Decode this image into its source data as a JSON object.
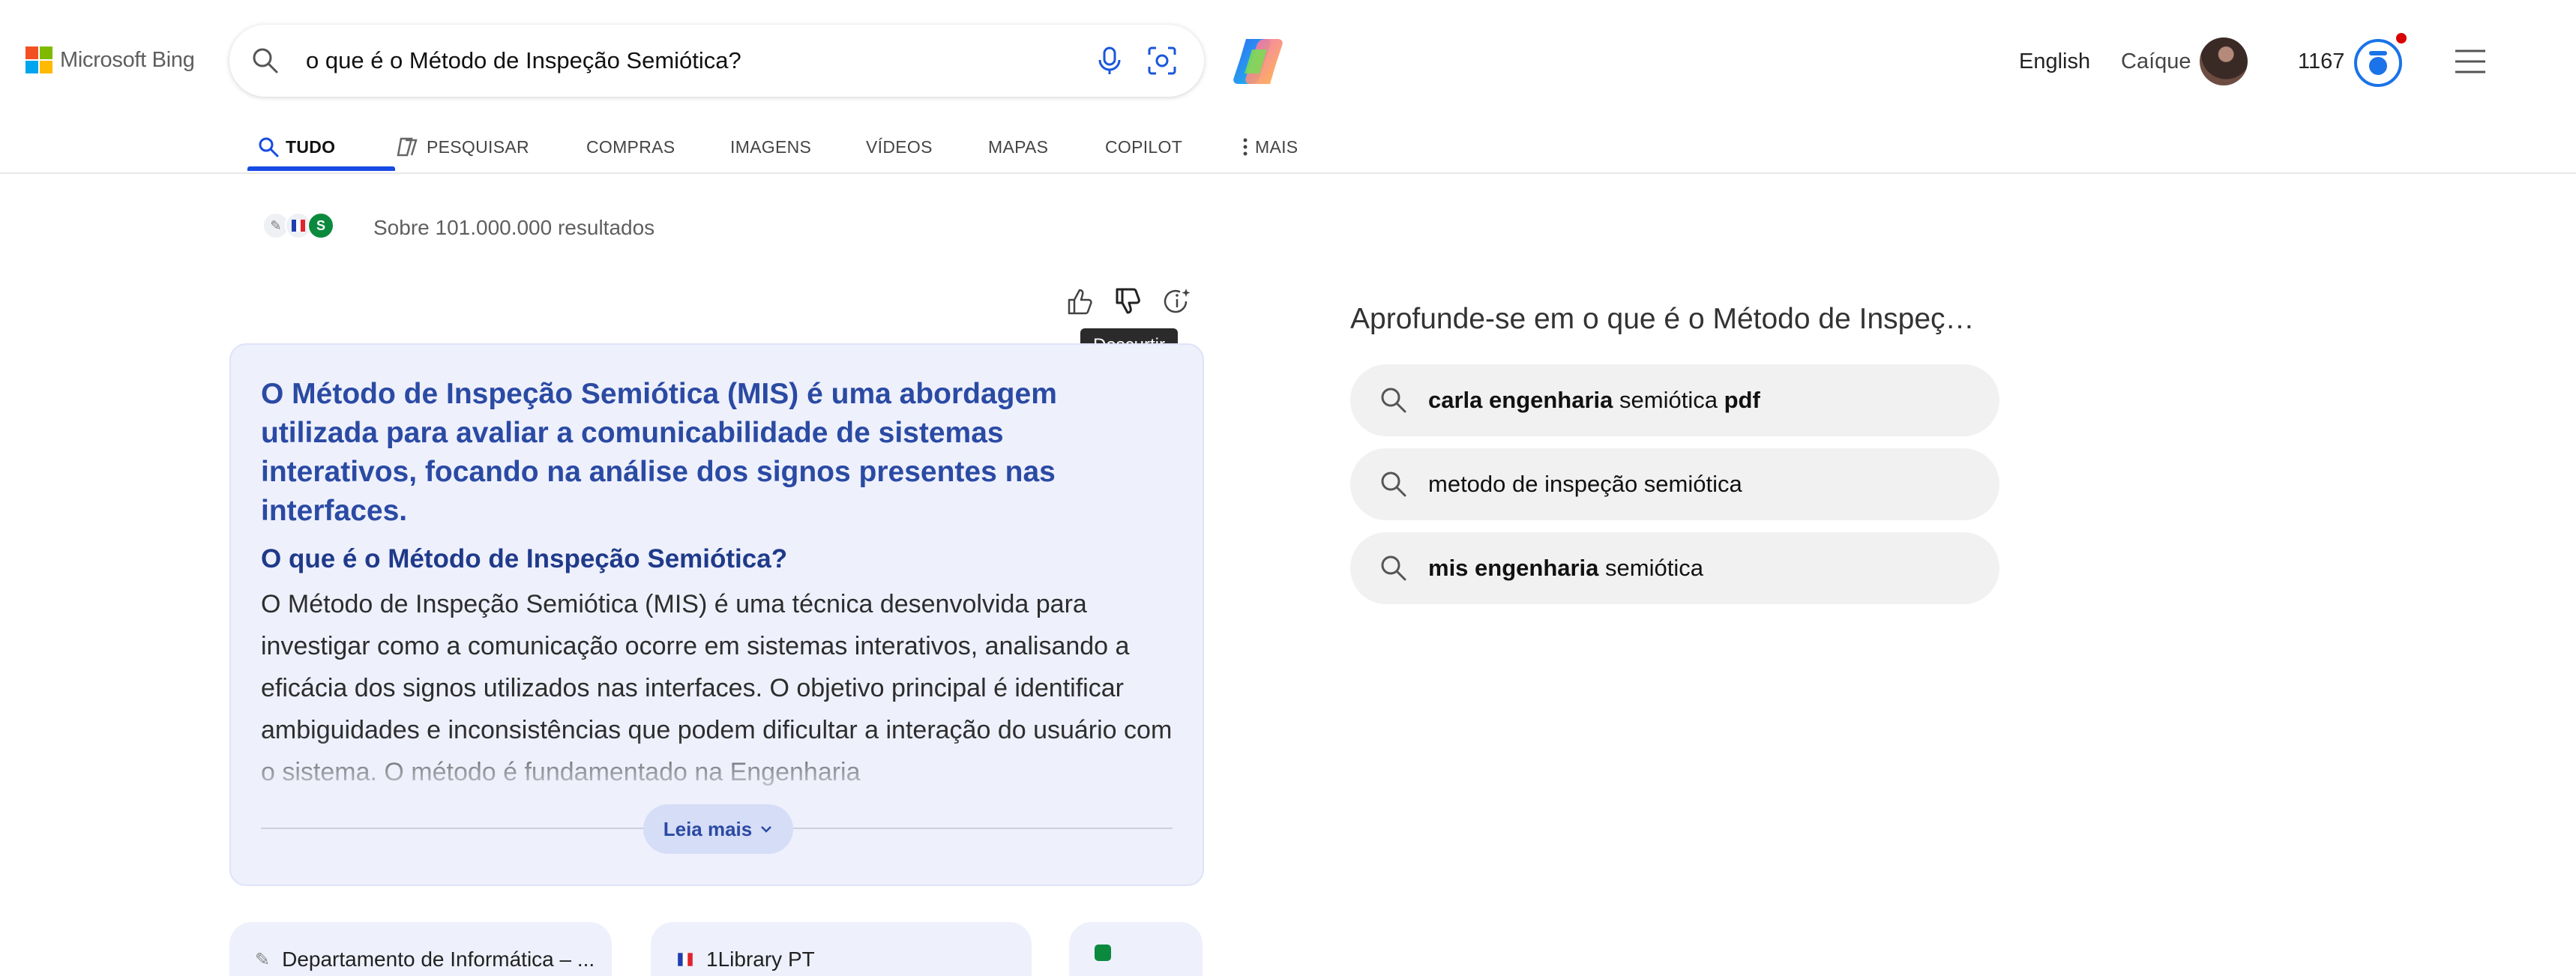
{
  "header": {
    "logo_text": "Microsoft Bing",
    "search_query": "o que é o Método de Inspeção Semiótica?",
    "language_link": "English",
    "user_name": "Caíque",
    "reward_points": "1167"
  },
  "nav": {
    "tabs": [
      {
        "label": "TUDO",
        "icon": "search-icon",
        "active": true
      },
      {
        "label": "PESQUISAR",
        "icon": "copilot-search-icon"
      },
      {
        "label": "COMPRAS"
      },
      {
        "label": "IMAGENS"
      },
      {
        "label": "VÍDEOS"
      },
      {
        "label": "MAPAS"
      },
      {
        "label": "COPILOT"
      },
      {
        "label": "MAIS",
        "icon": "more-vertical-icon"
      }
    ]
  },
  "results": {
    "count_text": "Sobre 101.000.000 resultados",
    "tooltip": "Descurtir"
  },
  "answer": {
    "headline": "O Método de Inspeção Semiótica (MIS) é uma abordagem utilizada para avaliar a comunicabilidade de sistemas interativos, focando na análise dos signos presentes nas interfaces.",
    "subheading": "O que é o Método de Inspeção Semiótica?",
    "body": "O Método de Inspeção Semiótica (MIS) é uma técnica desenvolvida para investigar como a comunicação ocorre em sistemas interativos, analisando a eficácia dos signos utilizados nas interfaces. O objetivo principal é identificar ambiguidades e inconsistências que podem dificultar a interação do usuário com o sistema. O método é fundamentado na Engenharia",
    "read_more": "Leia mais"
  },
  "sources": [
    {
      "label": "Departamento de Informática – ..."
    },
    {
      "label": "1Library PT"
    },
    {
      "label": ""
    }
  ],
  "related": {
    "title": "Aprofunde-se em o que é o Método de Inspeç…",
    "items": [
      {
        "parts": [
          {
            "text": "carla engenharia",
            "bold": true
          },
          {
            "text": " semiótica ",
            "bold": false
          },
          {
            "text": "pdf",
            "bold": true
          }
        ]
      },
      {
        "parts": [
          {
            "text": "metodo de inspeção semiótica",
            "bold": false
          }
        ]
      },
      {
        "parts": [
          {
            "text": "mis engenharia",
            "bold": true
          },
          {
            "text": " semiótica",
            "bold": false
          }
        ]
      }
    ]
  }
}
